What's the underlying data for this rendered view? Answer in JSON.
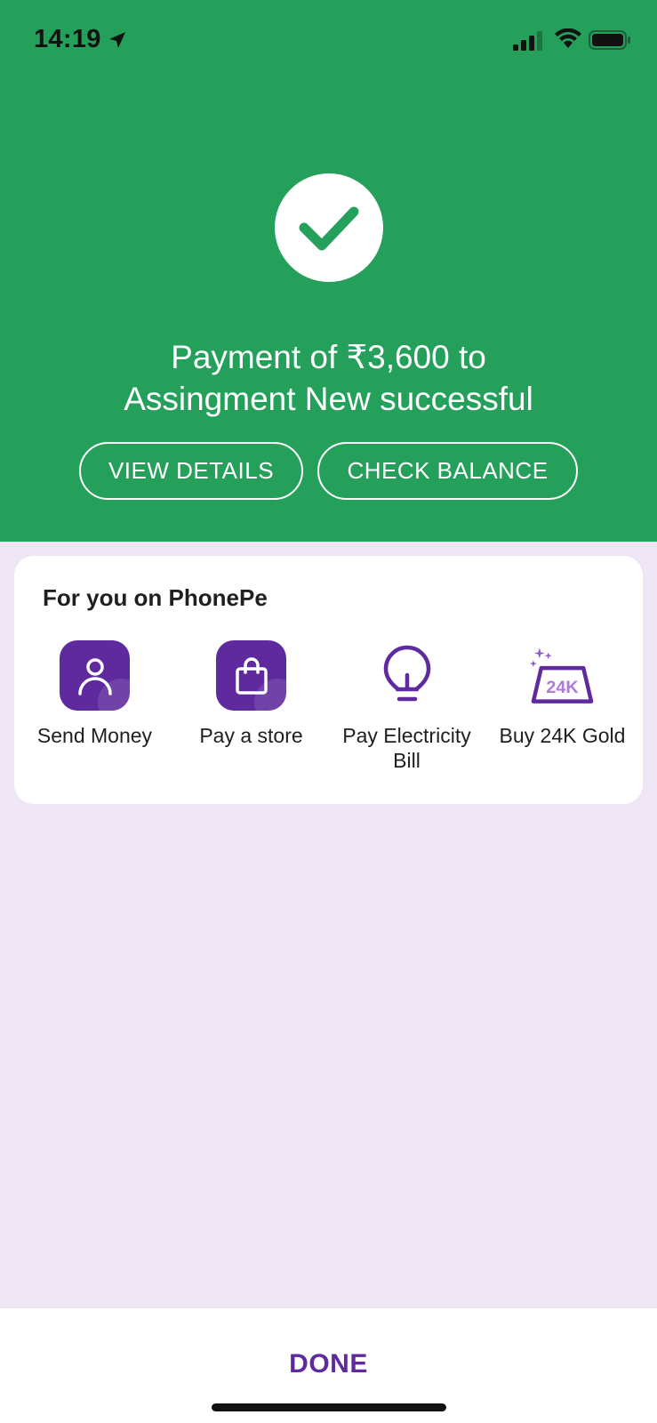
{
  "status_bar": {
    "time": "14:19",
    "icons": [
      "location-arrow-icon",
      "signal-icon",
      "wifi-icon",
      "battery-icon"
    ]
  },
  "payment": {
    "status_icon": "checkmark-icon",
    "message_line1": "Payment of ₹3,600 to",
    "message_line2": "Assingment New successful",
    "view_details_label": "VIEW DETAILS",
    "check_balance_label": "CHECK BALANCE"
  },
  "for_you": {
    "title": "For you on PhonePe",
    "actions": [
      {
        "label": "Send Money",
        "icon": "person-icon"
      },
      {
        "label": "Pay a store",
        "icon": "shopping-bag-icon"
      },
      {
        "label": "Pay Electricity Bill",
        "icon": "lightbulb-icon"
      },
      {
        "label": "Buy 24K Gold",
        "icon": "gold-bar-icon",
        "icon_text": "24K"
      }
    ]
  },
  "footer": {
    "done_label": "DONE"
  },
  "colors": {
    "success_green": "#24a05b",
    "brand_purple": "#5e2a9e",
    "page_background": "#efe6f5"
  }
}
